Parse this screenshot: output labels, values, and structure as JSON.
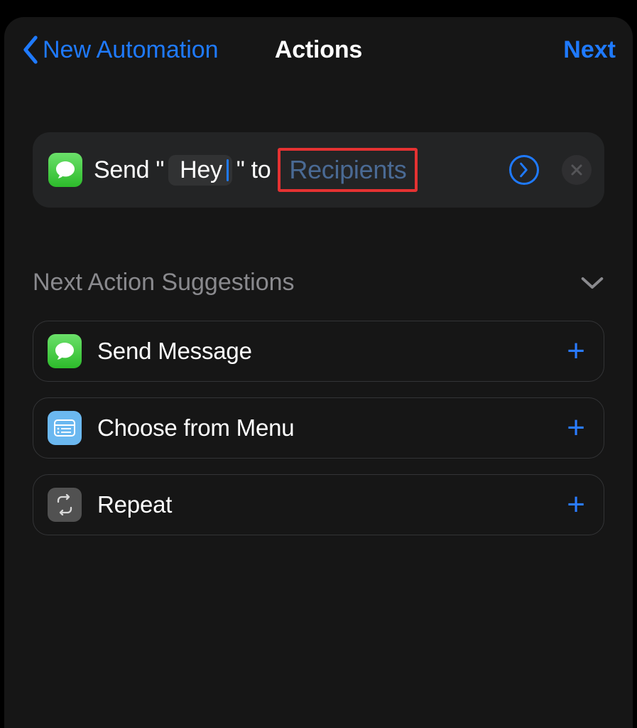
{
  "nav": {
    "back_label": "New Automation",
    "title": "Actions",
    "next_label": "Next"
  },
  "action": {
    "prefix": "Send \"",
    "message": "Hey",
    "mid": "\" to",
    "recipients_placeholder": "Recipients"
  },
  "suggestions": {
    "header": "Next Action Suggestions",
    "items": [
      {
        "label": "Send Message",
        "icon": "messages"
      },
      {
        "label": "Choose from Menu",
        "icon": "menu"
      },
      {
        "label": "Repeat",
        "icon": "repeat"
      }
    ]
  }
}
